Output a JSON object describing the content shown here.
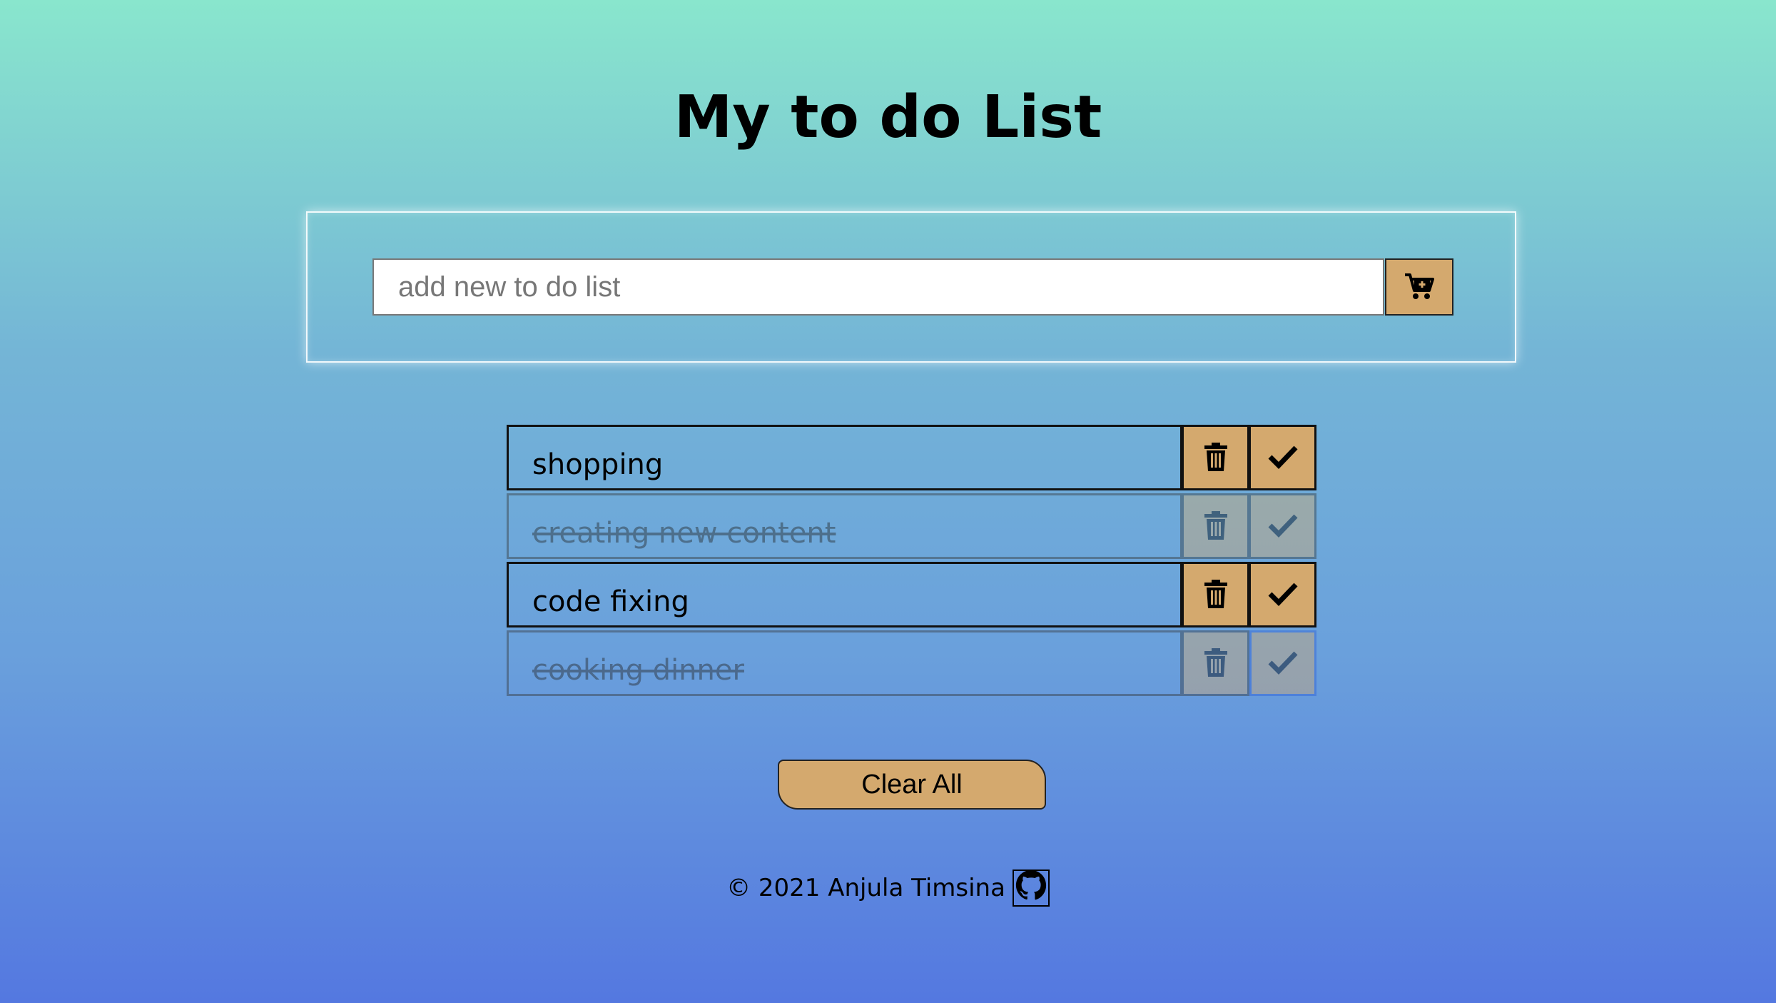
{
  "header": {
    "title": "My to do List"
  },
  "input_panel": {
    "placeholder": "add new to do list",
    "value": "",
    "add_icon": "cart-plus-icon"
  },
  "todos": [
    {
      "text": "shopping",
      "completed": false
    },
    {
      "text": "creating new content",
      "completed": true
    },
    {
      "text": "code fixing",
      "completed": false
    },
    {
      "text": "cooking dinner",
      "completed": true
    }
  ],
  "icons": {
    "delete": "trash-icon",
    "complete": "check-icon",
    "github": "github-icon"
  },
  "clear_label": "Clear All",
  "footer": {
    "copyright": "© 2021 Anjula Timsina"
  },
  "colors": {
    "accent": "#d4a96e",
    "gradient_top": "#89e6cd",
    "gradient_bottom": "#5478e0"
  }
}
